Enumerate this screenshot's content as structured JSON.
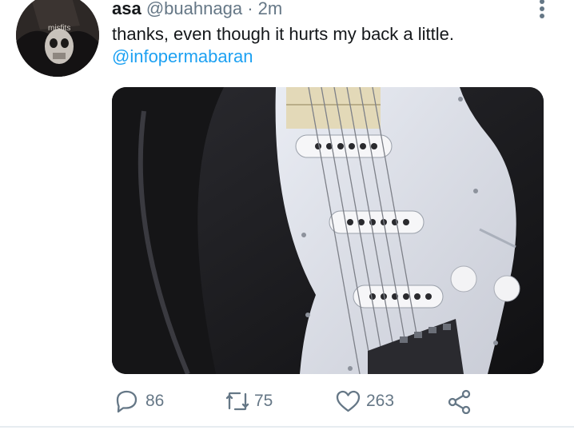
{
  "tweet": {
    "author_name": "asa",
    "handle": "@buahnaga",
    "separator": "·",
    "time": "2m",
    "text": "thanks, even though it hurts my back a little.",
    "mention": "@infopermabaran",
    "media_description": "photo of a white electric guitar body with pickups and knobs"
  },
  "actions": {
    "replies": "86",
    "retweets": "75",
    "likes": "263"
  },
  "colors": {
    "link": "#1da1f2",
    "secondary_text": "#657786",
    "primary_text": "#14171a"
  },
  "icons": [
    "more-vertical-icon",
    "reply-icon",
    "retweet-icon",
    "like-icon",
    "share-icon"
  ]
}
